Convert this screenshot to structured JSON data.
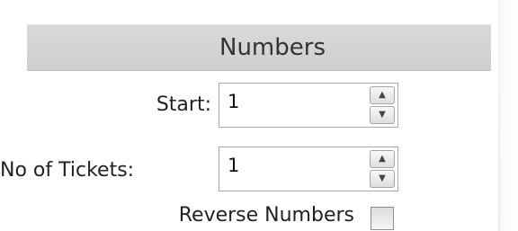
{
  "panel": {
    "title": "Numbers"
  },
  "start": {
    "label": "Start:",
    "value": "1",
    "up_icon": "▲",
    "down_icon": "▼"
  },
  "tickets": {
    "label": "No of Tickets:",
    "value": "1",
    "up_icon": "▲",
    "down_icon": "▼"
  },
  "reverse": {
    "label": "Reverse Numbers",
    "checked": false
  }
}
